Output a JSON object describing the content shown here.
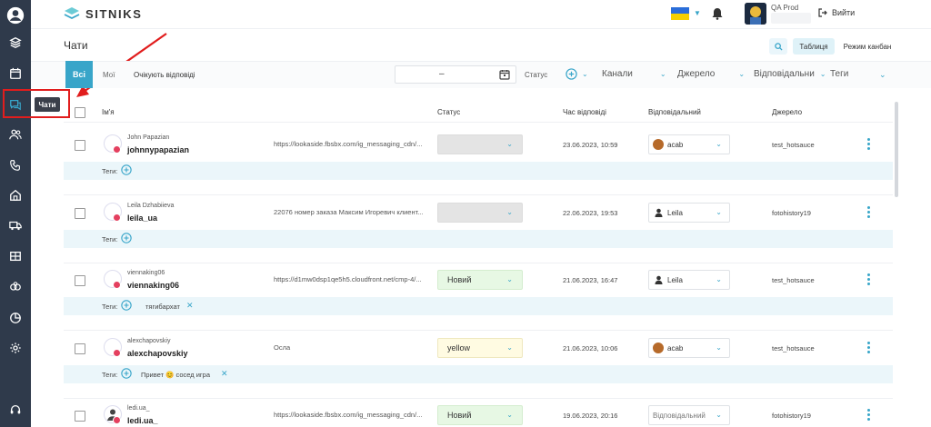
{
  "app": {
    "logo_text": "SITNIKS",
    "account_name": "QA Prod",
    "logout_label": "Вийти"
  },
  "tooltip": "Чати",
  "page": {
    "title": "Чати",
    "view_table": "Таблиця",
    "view_kanban": "Режим канбан"
  },
  "filters": {
    "tab_all": "Всі",
    "tab_mine": "Мої",
    "tab_waiting": "Очікують відповіді",
    "date_separator": "–",
    "status_label": "Статус",
    "channels": "Канали",
    "source": "Джерело",
    "responsible": "Відповідальни",
    "tags": "Теги"
  },
  "table": {
    "headers": {
      "name": "Ім'я",
      "status": "Статус",
      "response_time": "Час відповіді",
      "responsible": "Відповідальний",
      "source": "Джерело"
    },
    "tags_label": "Теги:",
    "responsible_placeholder": "Відповідальний",
    "rows": [
      {
        "name": "John Papazian",
        "username": "johnnypapazian",
        "message": "https://lookaside.fbsbx.com/ig_messaging_cdn/...",
        "status": "",
        "time": "23.06.2023, 10:59",
        "responsible": "acab",
        "source": "test_hotsauce",
        "tags": []
      },
      {
        "name": "Leila Dzhabiieva",
        "username": "leila_ua",
        "message": "22076 номер заказа Максим Игоревич клиент...",
        "status": "",
        "time": "22.06.2023, 19:53",
        "responsible": "Leila",
        "source": "fotohistory19",
        "tags": []
      },
      {
        "name": "viennaking06",
        "username": "viennaking06",
        "message": "https://d1mw0dsp1qe5h5.cloudfront.net/cmp-4/...",
        "status": "Новий",
        "time": "21.06.2023, 16:47",
        "responsible": "Leila",
        "source": "test_hotsauce",
        "tags": [
          "тягибархат"
        ]
      },
      {
        "name": "alexchapovskiy",
        "username": "alexchapovskiy",
        "message": "Осла",
        "status": "yellow",
        "time": "21.06.2023, 10:06",
        "responsible": "acab",
        "source": "test_hotsauce",
        "tags": [
          "Привет 😊 сосед игра"
        ]
      },
      {
        "name": "ledi.ua_",
        "username": "ledi.ua_",
        "message": "https://lookaside.fbsbx.com/ig_messaging_cdn/...",
        "status": "Новий",
        "time": "19.06.2023, 20:16",
        "responsible": "",
        "source": "fotohistory19",
        "tags": []
      }
    ]
  },
  "colors": {
    "sidebar": "#2f3a4b",
    "accent": "#38a5c9",
    "annotation": "#e11d1d",
    "tag_row": "#ebf6fa"
  }
}
